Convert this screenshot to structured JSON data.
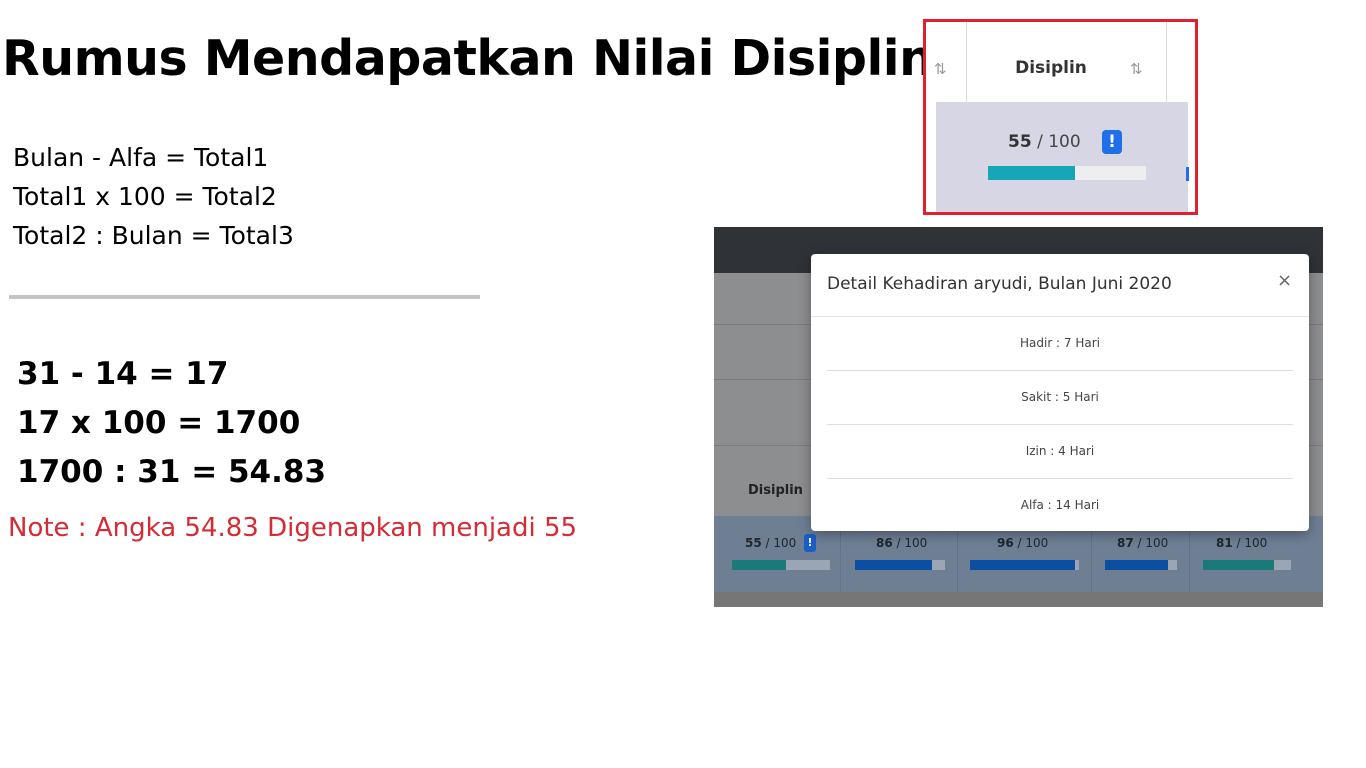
{
  "title": "Rumus Mendapatkan Nilai Disiplin",
  "formulas": [
    "Bulan - Alfa = Total1",
    "Total1 x 100 = Total2",
    "Total2 : Bulan = Total3"
  ],
  "calculations": [
    "31 - 14 = 17",
    "17 x 100 = 1700",
    "1700 : 31 = 54.83"
  ],
  "note": "Note : Angka 54.83 Digenapkan menjadi 55",
  "colors": {
    "note": "#d52b35",
    "highlight_border": "#e0202f",
    "progress": "#17a5b8",
    "badge": "#1e6fe8"
  },
  "zoom": {
    "column_header": "Disiplin",
    "sort_icon": "sort-arrows-icon",
    "score": "55",
    "score_max": "/ 100",
    "badge": "!",
    "progress_percent": 55
  },
  "screenshot": {
    "column_header": "Disiplin",
    "scores": [
      {
        "value": "55",
        "max": "/ 100",
        "percent": 55,
        "color": "#1a7a7a"
      },
      {
        "value": "86",
        "max": "/ 100",
        "percent": 86,
        "color": "#0b4fa3"
      },
      {
        "value": "96",
        "max": "/ 100",
        "percent": 96,
        "color": "#0b4fa3"
      },
      {
        "value": "87",
        "max": "/ 100",
        "percent": 87,
        "color": "#0b4fa3"
      },
      {
        "value": "81",
        "max": "/ 100",
        "percent": 81,
        "color": "#1a7a7a"
      }
    ],
    "badge": "!"
  },
  "modal": {
    "title": "Detail Kehadiran aryudi, Bulan Juni 2020",
    "close": "×",
    "items": [
      "Hadir : 7 Hari",
      "Sakit : 5 Hari",
      "Izin : 4 Hari",
      "Alfa : 14 Hari"
    ]
  }
}
